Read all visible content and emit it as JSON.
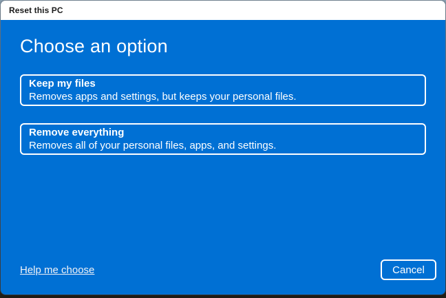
{
  "window": {
    "title": "Reset this PC"
  },
  "dialog": {
    "heading": "Choose an option",
    "options": [
      {
        "title": "Keep my files",
        "description": "Removes apps and settings, but keeps your personal files."
      },
      {
        "title": "Remove everything",
        "description": "Removes all of your personal files, apps, and settings."
      }
    ],
    "help_link": "Help me choose",
    "cancel_label": "Cancel"
  },
  "colors": {
    "accent_blue": "#0070d4",
    "titlebar_bg": "#ffffff",
    "titlebar_text": "#1a1a1a",
    "option_border": "#ffffff",
    "text_on_accent": "#ffffff"
  }
}
